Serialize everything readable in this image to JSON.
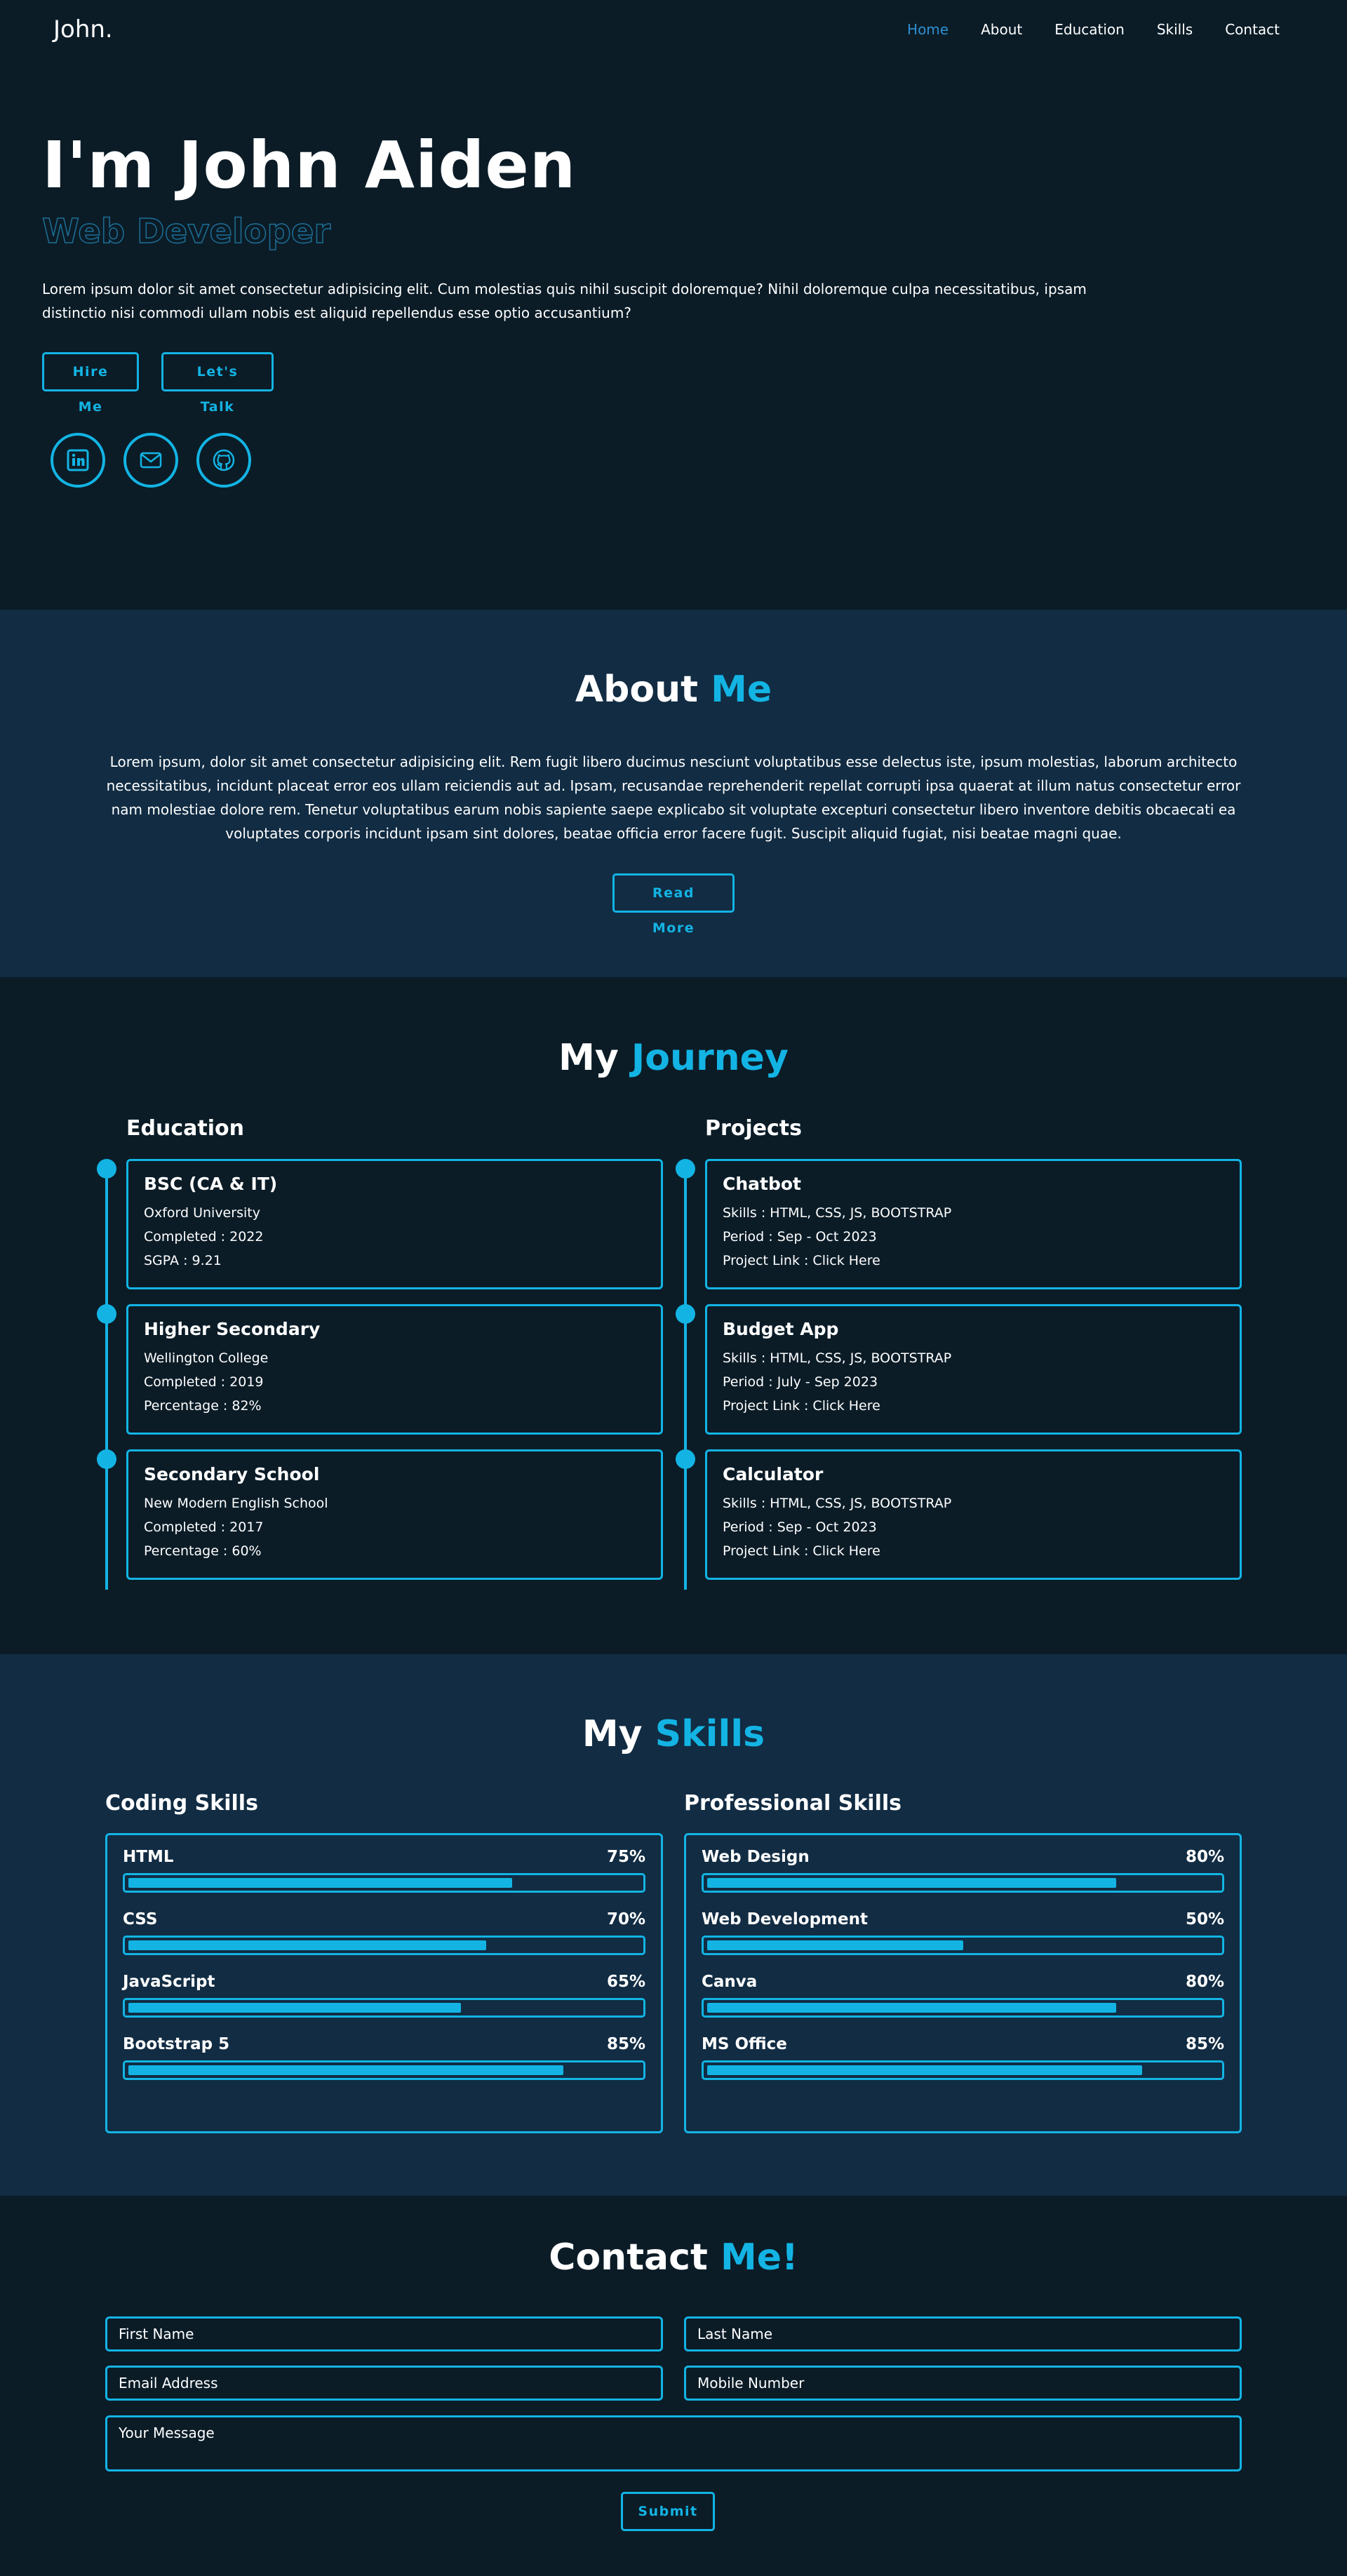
{
  "header": {
    "logo": "John.",
    "nav": [
      {
        "label": "Home",
        "active": true
      },
      {
        "label": "About",
        "active": false
      },
      {
        "label": "Education",
        "active": false
      },
      {
        "label": "Skills",
        "active": false
      },
      {
        "label": "Contact",
        "active": false
      }
    ]
  },
  "hero": {
    "name": "I'm John Aiden",
    "role": "Web Developer",
    "description": "Lorem ipsum dolor sit amet consectetur adipisicing elit. Cum molestias quis nihil suscipit doloremque? Nihil doloremque culpa necessitatibus, ipsam distinctio nisi commodi ullam nobis est aliquid repellendus esse optio accusantium?",
    "hire_label": "Hire Me",
    "talk_label": "Let's Talk",
    "socials": [
      "linkedin-icon",
      "mail-icon",
      "github-icon"
    ]
  },
  "about": {
    "title_main": "About",
    "title_accent": "Me",
    "text": "Lorem ipsum, dolor sit amet consectetur adipisicing elit. Rem fugit libero ducimus nesciunt voluptatibus esse delectus iste, ipsum molestias, laborum architecto necessitatibus, incidunt placeat error eos ullam reiciendis aut ad. Ipsam, recusandae reprehenderit repellat corrupti ipsa quaerat at illum natus consectetur error nam molestiae dolore rem. Tenetur voluptatibus earum nobis sapiente saepe explicabo sit voluptate excepturi consectetur libero inventore debitis obcaecati ea voluptates corporis incidunt ipsam sint dolores, beatae officia error facere fugit. Suscipit aliquid fugiat, nisi beatae magni quae.",
    "read_more_label": "Read More"
  },
  "journey": {
    "title_main": "My",
    "title_accent": "Journey",
    "education": {
      "title": "Education",
      "items": [
        {
          "title": "BSC (CA & IT)",
          "lines": [
            "Oxford University",
            "Completed : 2022",
            "SGPA : 9.21"
          ]
        },
        {
          "title": "Higher Secondary",
          "lines": [
            "Wellington College",
            "Completed : 2019",
            "Percentage : 82%"
          ]
        },
        {
          "title": "Secondary School",
          "lines": [
            "New Modern English School",
            "Completed : 2017",
            "Percentage : 60%"
          ]
        }
      ]
    },
    "projects": {
      "title": "Projects",
      "items": [
        {
          "title": "Chatbot",
          "lines": [
            "Skills : HTML, CSS, JS, BOOTSTRAP",
            "Period : Sep - Oct 2023",
            "Project Link : Click Here"
          ]
        },
        {
          "title": "Budget App",
          "lines": [
            "Skills : HTML, CSS, JS, BOOTSTRAP",
            "Period : July - Sep 2023",
            "Project Link : Click Here"
          ]
        },
        {
          "title": "Calculator",
          "lines": [
            "Skills : HTML, CSS, JS, BOOTSTRAP",
            "Period : Sep - Oct 2023",
            "Project Link : Click Here"
          ]
        }
      ]
    }
  },
  "skills": {
    "title_main": "My",
    "title_accent": "Skills",
    "coding": {
      "title": "Coding Skills",
      "items": [
        {
          "name": "HTML",
          "percent_label": "75%",
          "fill": 0.75
        },
        {
          "name": "CSS",
          "percent_label": "70%",
          "fill": 0.7
        },
        {
          "name": "JavaScript",
          "percent_label": "65%",
          "fill": 0.65
        },
        {
          "name": "Bootstrap 5",
          "percent_label": "85%",
          "fill": 0.85
        }
      ]
    },
    "professional": {
      "title": "Professional Skills",
      "items": [
        {
          "name": "Web Design",
          "percent_label": "80%",
          "fill": 0.8
        },
        {
          "name": "Web Development",
          "percent_label": "50%",
          "fill": 0.5
        },
        {
          "name": "Canva",
          "percent_label": "80%",
          "fill": 0.8
        },
        {
          "name": "MS Office",
          "percent_label": "85%",
          "fill": 0.85
        }
      ]
    }
  },
  "contact": {
    "title_main": "Contact",
    "title_accent": "Me!",
    "first_name_placeholder": "First Name",
    "last_name_placeholder": "Last Name",
    "email_placeholder": "Email Address",
    "mobile_placeholder": "Mobile Number",
    "message_placeholder": "Your Message",
    "submit_label": "Submit"
  },
  "colors": {
    "background": "#0b1c27",
    "section_alt": "#112c43",
    "accent": "#13b4e4",
    "nav_active": "#2e8fd0"
  }
}
